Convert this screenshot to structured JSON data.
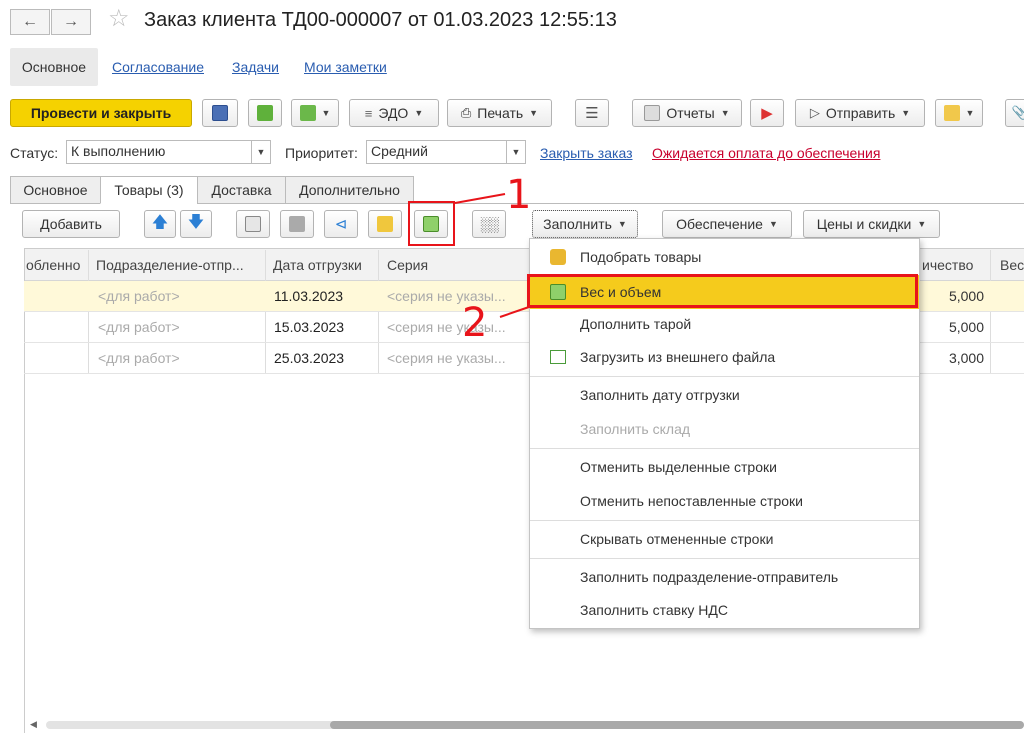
{
  "window": {
    "title": "Заказ клиента ТД00-000007 от 01.03.2023 12:55:13"
  },
  "nav_tabs": [
    "Основное",
    "Согласование",
    "Задачи",
    "Мои заметки"
  ],
  "toolbar": {
    "post_close": "Провести и закрыть",
    "edo": "ЭДО",
    "print": "Печать",
    "reports": "Отчеты",
    "send": "Отправить"
  },
  "status": {
    "label": "Статус:",
    "value": "К выполнению",
    "priority_label": "Приоритет:",
    "priority_value": "Средний",
    "close_order": "Закрыть заказ",
    "waiting_payment": "Ожидается оплата до обеспечения"
  },
  "content_tabs": [
    "Основное",
    "Товары (3)",
    "Доставка",
    "Дополнительно"
  ],
  "table_toolbar": {
    "add": "Добавить",
    "fill": "Заполнить",
    "provision": "Обеспечение",
    "prices": "Цены и скидки"
  },
  "columns": [
    "обленно",
    "Подразделение-отпр...",
    "Дата отгрузки",
    "Серия",
    "ичество",
    "Вес"
  ],
  "rows": [
    {
      "dept": "<для работ>",
      "date": "11.03.2023",
      "series": "<серия не указы...",
      "qty": "5,000"
    },
    {
      "dept": "<для работ>",
      "date": "15.03.2023",
      "series": "<серия не указы...",
      "qty": "5,000"
    },
    {
      "dept": "<для работ>",
      "date": "25.03.2023",
      "series": "<серия не указы...",
      "qty": "3,000"
    }
  ],
  "menu": {
    "items": [
      "Подобрать товары",
      "Вес и объем",
      "Дополнить тарой",
      "Загрузить из внешнего файла",
      "Заполнить дату отгрузки",
      "Заполнить склад",
      "Отменить выделенные строки",
      "Отменить непоставленные строки",
      "Скрывать отмененные строки",
      "Заполнить подразделение-отправитель",
      "Заполнить ставку НДС"
    ]
  },
  "annotations": {
    "one": "1",
    "two": "2"
  },
  "colors": {
    "accent_yellow": "#f5d200",
    "highlight_row": "#fff9d9",
    "annotation_red": "#e8141a",
    "link_blue": "#2a5db0"
  }
}
